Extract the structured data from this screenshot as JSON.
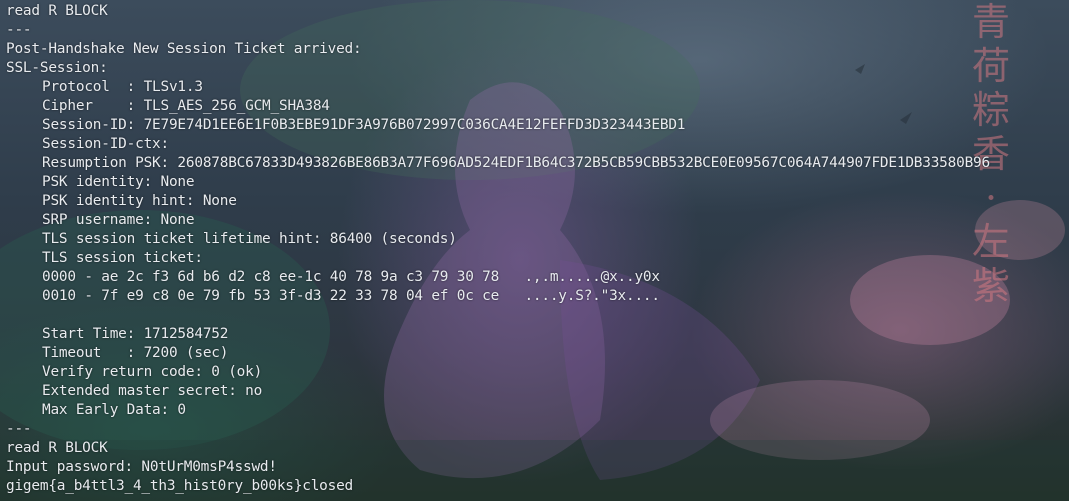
{
  "watermark_text": "青荷粽香·左紫",
  "colors": {
    "text": "#e8ebef",
    "background": "#2f3d4b"
  },
  "terminal": {
    "lines": [
      {
        "text": "read R BLOCK",
        "indent": false
      },
      {
        "text": "---",
        "indent": false
      },
      {
        "text": "Post-Handshake New Session Ticket arrived:",
        "indent": false
      },
      {
        "text": "SSL-Session:",
        "indent": false
      },
      {
        "text": "Protocol  : TLSv1.3",
        "indent": true
      },
      {
        "text": "Cipher    : TLS_AES_256_GCM_SHA384",
        "indent": true
      },
      {
        "text": "Session-ID: 7E79E74D1EE6E1F0B3EBE91DF3A976B072997C036CA4E12FEFFD3D323443EBD1",
        "indent": true
      },
      {
        "text": "Session-ID-ctx:",
        "indent": true
      },
      {
        "text": "Resumption PSK: 260878BC67833D493826BE86B3A77F696AD524EDF1B64C372B5CB59CBB532BCE0E09567C064A744907FDE1DB33580B96",
        "indent": true
      },
      {
        "text": "PSK identity: None",
        "indent": true
      },
      {
        "text": "PSK identity hint: None",
        "indent": true
      },
      {
        "text": "SRP username: None",
        "indent": true
      },
      {
        "text": "TLS session ticket lifetime hint: 86400 (seconds)",
        "indent": true
      },
      {
        "text": "TLS session ticket:",
        "indent": true
      },
      {
        "text": "0000 - ae 2c f3 6d b6 d2 c8 ee-1c 40 78 9a c3 79 30 78   .,.m.....@x..y0x",
        "indent": true
      },
      {
        "text": "0010 - 7f e9 c8 0e 79 fb 53 3f-d3 22 33 78 04 ef 0c ce   ....y.S?.\"3x....",
        "indent": true
      },
      {
        "text": "",
        "indent": true
      },
      {
        "text": "Start Time: 1712584752",
        "indent": true
      },
      {
        "text": "Timeout   : 7200 (sec)",
        "indent": true
      },
      {
        "text": "Verify return code: 0 (ok)",
        "indent": true
      },
      {
        "text": "Extended master secret: no",
        "indent": true
      },
      {
        "text": "Max Early Data: 0",
        "indent": true
      },
      {
        "text": "---",
        "indent": false
      },
      {
        "text": "read R BLOCK",
        "indent": false
      },
      {
        "text": "Input password: N0tUrM0msP4sswd!",
        "indent": false
      },
      {
        "text": "gigem{a_b4ttl3_4_th3_hist0ry_b00ks}closed",
        "indent": false
      }
    ]
  }
}
